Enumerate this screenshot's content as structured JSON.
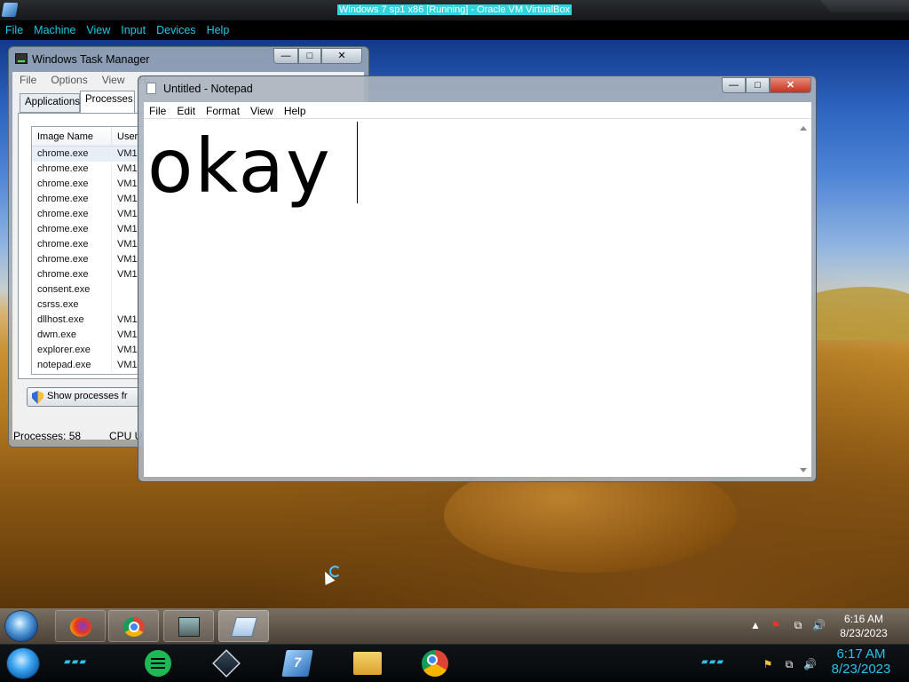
{
  "host": {
    "title": "Windows 7 sp1 x86 [Running] - Oracle VM VirtualBox",
    "menus": [
      "File",
      "Machine",
      "View",
      "Input",
      "Devices",
      "Help"
    ],
    "clock": {
      "time": "6:17 AM",
      "date": "8/23/2023"
    }
  },
  "taskmgr": {
    "title": "Windows Task Manager",
    "menus": [
      "File",
      "Options",
      "View",
      "H"
    ],
    "tabs": [
      "Applications",
      "Processes"
    ],
    "columns": [
      "Image Name",
      "User"
    ],
    "rows": [
      {
        "name": "chrome.exe",
        "user": "VM1"
      },
      {
        "name": "chrome.exe",
        "user": "VM1"
      },
      {
        "name": "chrome.exe",
        "user": "VM1"
      },
      {
        "name": "chrome.exe",
        "user": "VM1"
      },
      {
        "name": "chrome.exe",
        "user": "VM1"
      },
      {
        "name": "chrome.exe",
        "user": "VM1"
      },
      {
        "name": "chrome.exe",
        "user": "VM1"
      },
      {
        "name": "chrome.exe",
        "user": "VM1"
      },
      {
        "name": "chrome.exe",
        "user": "VM1"
      },
      {
        "name": "consent.exe",
        "user": ""
      },
      {
        "name": "csrss.exe",
        "user": ""
      },
      {
        "name": "dllhost.exe",
        "user": "VM1"
      },
      {
        "name": "dwm.exe",
        "user": "VM1"
      },
      {
        "name": "explorer.exe",
        "user": "VM1"
      },
      {
        "name": "notepad.exe",
        "user": "VM1"
      }
    ],
    "show_processes_label": "Show processes fr",
    "status_processes": "Processes: 58",
    "status_cpu": "CPU U",
    "ctl_min": "—",
    "ctl_max": "□",
    "ctl_close": "✕"
  },
  "notepad": {
    "title": "Untitled - Notepad",
    "menus": [
      "File",
      "Edit",
      "Format",
      "View",
      "Help"
    ],
    "content": "okay"
  },
  "guest_taskbar": {
    "clock": {
      "time": "6:16 AM",
      "date": "8/23/2023"
    },
    "tray_show": "▲",
    "tray_flag": "⚑",
    "tray_net": "⧉",
    "tray_vol": "🔊"
  },
  "dock": {
    "win7_label": "7",
    "deco_left": "▰▰▰",
    "deco_right": "▰▰▰"
  }
}
